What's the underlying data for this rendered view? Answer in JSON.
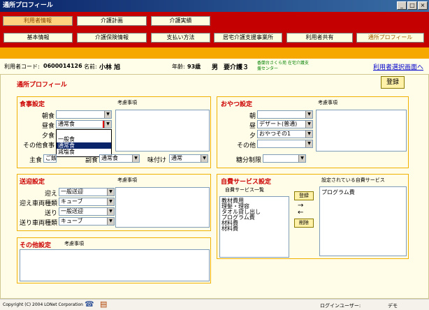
{
  "window": {
    "title": "通所プロフィール"
  },
  "tabs_row1": [
    {
      "label": "利用者情報",
      "active": true
    },
    {
      "label": "介護計画",
      "active": false
    },
    {
      "label": "介護実績",
      "active": false
    }
  ],
  "tabs_row2": [
    {
      "label": "基本情報",
      "light": false
    },
    {
      "label": "介護保険情報",
      "light": false
    },
    {
      "label": "支払い方法",
      "light": false
    },
    {
      "label": "居宅介護支援事業所",
      "light": false
    },
    {
      "label": "利用者共有",
      "light": false
    },
    {
      "label": "通所プロフィール",
      "light": true
    }
  ],
  "info": {
    "code_label": "利用者コード:",
    "code_value": "0600014126",
    "name_label": "名前:",
    "name_value": "小林 旭",
    "age_label": "年齢:",
    "age_value": "93歳",
    "gender": "男",
    "care_level": "要介護３",
    "facility_line1": "香蘭台さくら苑 在宅介護支",
    "facility_line2": "援センター",
    "link": "利用者選択画面へ"
  },
  "page_title": "通所プロフィール",
  "register_button": "登録",
  "note_label": "考慮事項",
  "meal": {
    "title": "食事設定",
    "breakfast_label": "朝食",
    "breakfast_value": "",
    "lunch_label": "昼食",
    "lunch_value": "通常食",
    "dinner_label": "夕食",
    "other_label": "その他食事",
    "staple_label": "主食",
    "staple_value": "ご飯",
    "side_label": "副食",
    "side_value": "通常食",
    "taste_label": "味付け",
    "taste_value": "通常",
    "dropdown_options": [
      "",
      "一般食",
      "通常食",
      "減塩食"
    ],
    "dropdown_selected": 2
  },
  "snack": {
    "title": "おやつ設定",
    "morning_label": "朝",
    "morning_value": "",
    "noon_label": "昼",
    "noon_value": "デザート(普通)",
    "evening_label": "夕",
    "evening_value": "おやつその1",
    "other_label": "その他",
    "sugar_label": "糖分制限",
    "sugar_value": ""
  },
  "transport": {
    "title": "送迎設定",
    "pickup_label": "迎え",
    "pickup_value": "一般送迎",
    "pickup_vehicle_label": "迎え車両種類",
    "pickup_vehicle_value": "キューブ",
    "dropoff_label": "送り",
    "dropoff_value": "一般送迎",
    "dropoff_vehicle_label": "送り車両種類",
    "dropoff_vehicle_value": "キューブ"
  },
  "other": {
    "title": "その他設定"
  },
  "self_pay": {
    "title": "自費サービス設定",
    "list_label": "自費サービス一覧",
    "selected_label": "設定されている自費サービス",
    "items": [
      "教材費用",
      "理髪・理容",
      "タオル貸し出し",
      "プログラム費",
      "材料費",
      "材料費"
    ],
    "selected_items": [
      "プログラム費"
    ],
    "register_btn": "登録",
    "delete_btn": "削除",
    "arrow_right": "→",
    "arrow_left": "←"
  },
  "status": {
    "copyright": "Copyright (C) 2004 LONet Corporation",
    "login_label": "ログインユーザー:",
    "login_value": "デモ"
  }
}
